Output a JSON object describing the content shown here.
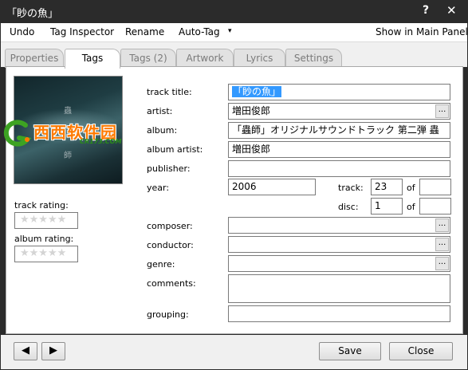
{
  "window": {
    "title": "「眇の魚」"
  },
  "titlebar": {
    "help_glyph": "?",
    "close_glyph": "✕"
  },
  "menu": {
    "undo": "Undo",
    "tag_inspector": "Tag Inspector",
    "rename": "Rename",
    "auto_tag": "Auto-Tag",
    "caret": "▾",
    "show_main": "Show in Main Panel"
  },
  "tabs": [
    {
      "label": "Properties",
      "active": false
    },
    {
      "label": "Tags",
      "active": true
    },
    {
      "label": "Tags (2)",
      "active": false
    },
    {
      "label": "Artwork",
      "active": false
    },
    {
      "label": "Lyrics",
      "active": false
    },
    {
      "label": "Settings",
      "active": false
    }
  ],
  "artwork": {
    "glyph_a": "蟲",
    "glyph_b": "師"
  },
  "watermark": {
    "text": "西西软件园",
    "sub": "CR173.COM"
  },
  "ratings": {
    "track_label": "track rating:",
    "album_label": "album rating:",
    "track_stars": "★★★★★",
    "album_stars": "★★★★★",
    "track_value": 0,
    "album_value": 0
  },
  "fields": {
    "track_title": {
      "label": "track title:",
      "value": "「眇の魚」"
    },
    "artist": {
      "label": "artist:",
      "value": "増田俊郎"
    },
    "album": {
      "label": "album:",
      "value": "「蟲師」オリジナルサウンドトラック 第二弾 蟲"
    },
    "album_artist": {
      "label": "album artist:",
      "value": "増田俊郎"
    },
    "publisher": {
      "label": "publisher:",
      "value": ""
    },
    "year": {
      "label": "year:",
      "value": "2006"
    },
    "track": {
      "label": "track:",
      "value": "23",
      "of_label": "of",
      "of_value": ""
    },
    "disc": {
      "label": "disc:",
      "value": "1",
      "of_label": "of",
      "of_value": ""
    },
    "composer": {
      "label": "composer:",
      "value": ""
    },
    "conductor": {
      "label": "conductor:",
      "value": ""
    },
    "genre": {
      "label": "genre:",
      "value": ""
    },
    "comments": {
      "label": "comments:",
      "value": ""
    },
    "grouping": {
      "label": "grouping:",
      "value": ""
    }
  },
  "ellipsis": "...",
  "bottom": {
    "prev_glyph": "◀",
    "next_glyph": "▶",
    "save": "Save",
    "close": "Close"
  },
  "colors": {
    "titlebar_bg": "#2b2b2b",
    "selection": "#3399ff",
    "watermark_orange": "#ff7a00",
    "watermark_green": "#2a8c1a"
  }
}
